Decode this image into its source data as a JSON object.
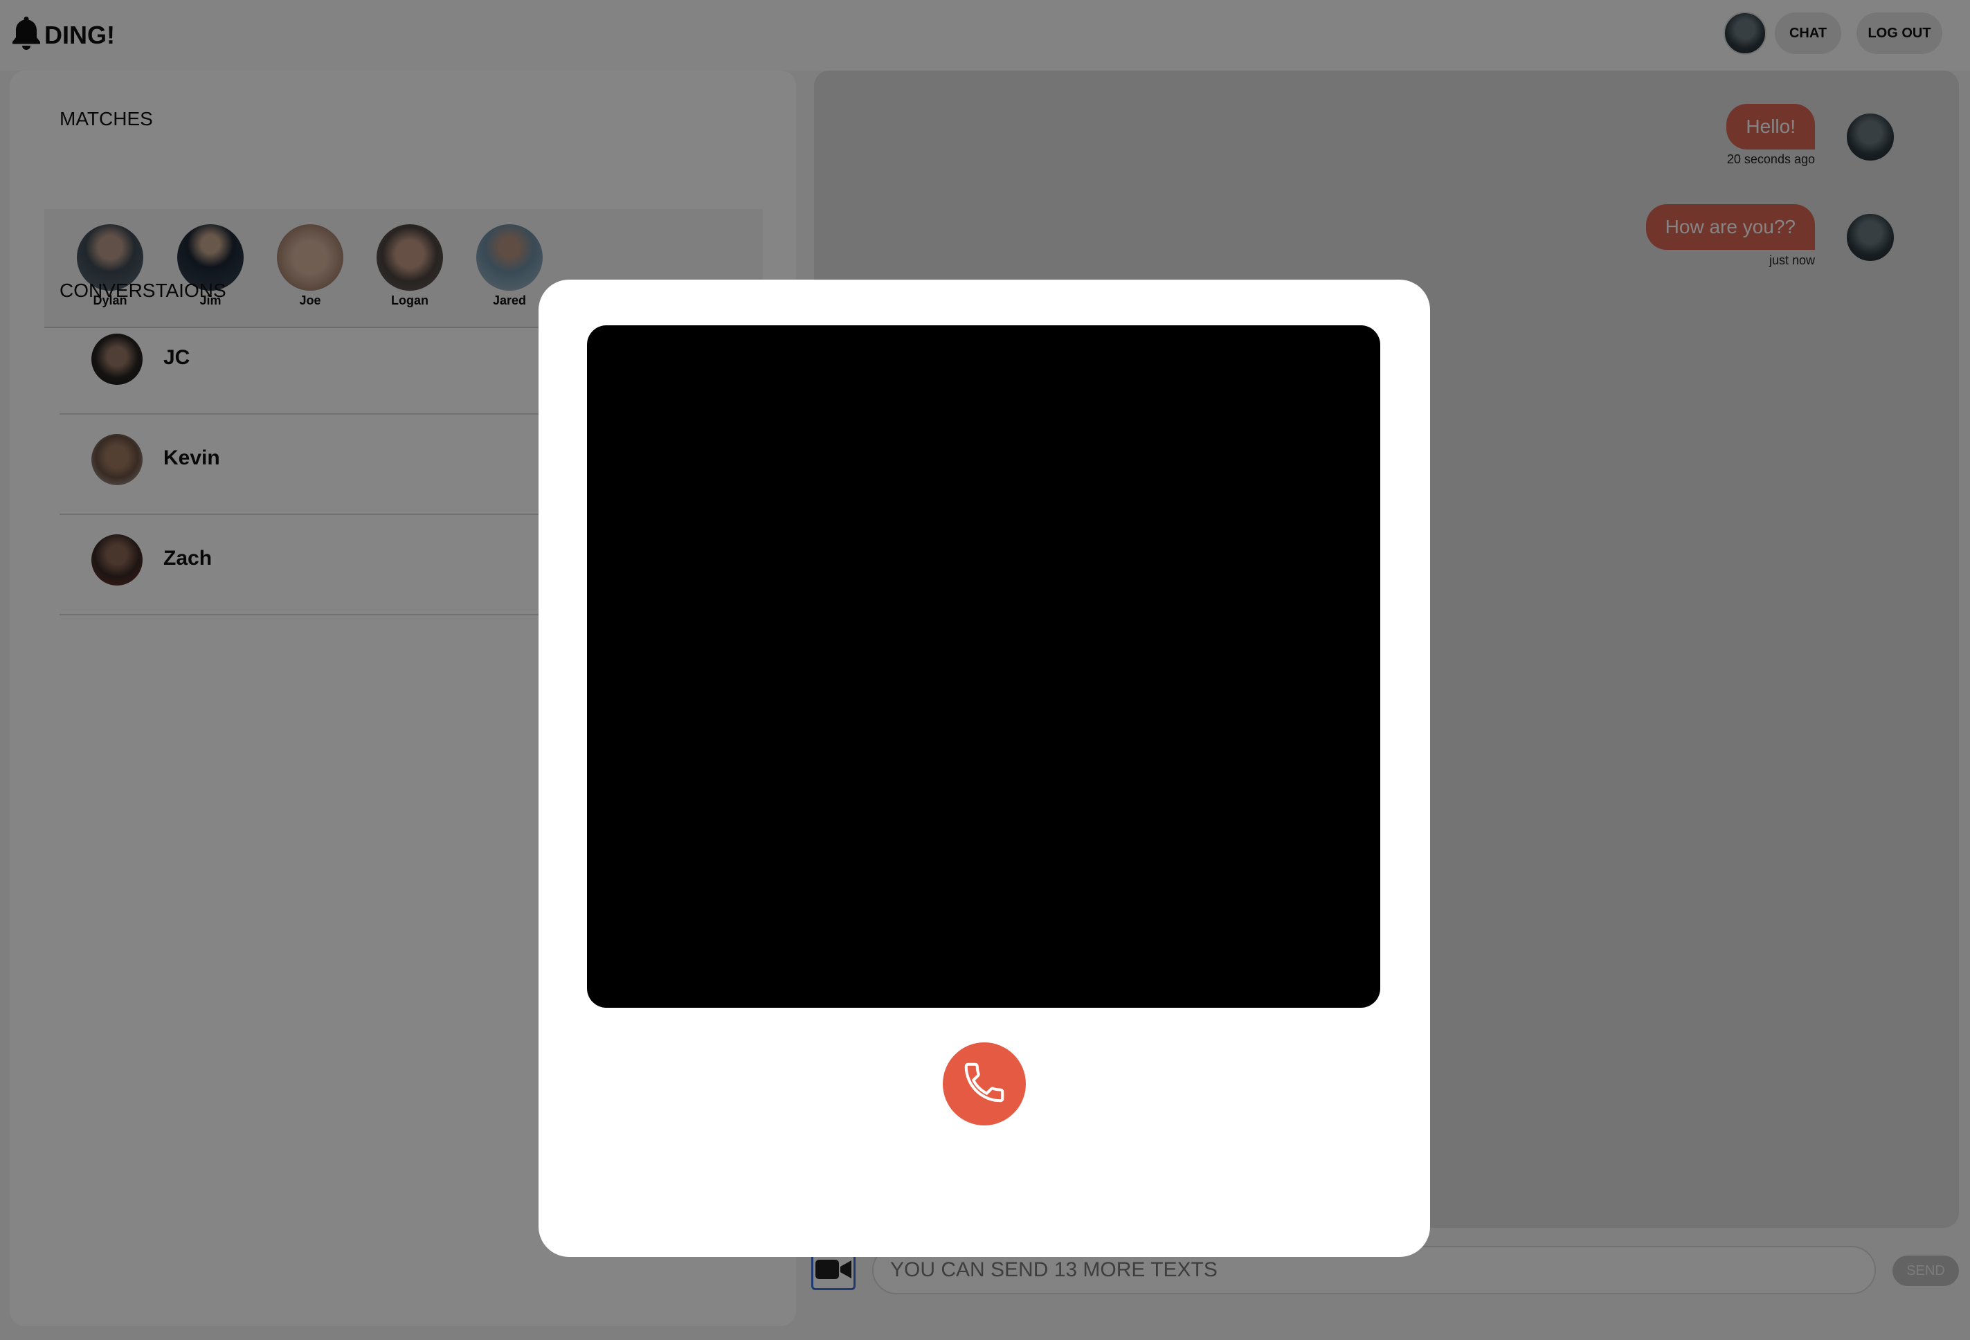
{
  "header": {
    "app_name": "DING!",
    "logo_icon": "bell-icon",
    "chat_label": "CHAT",
    "logout_label": "LOG OUT"
  },
  "matches": {
    "title": "MATCHES",
    "people": [
      {
        "name": "Dylan",
        "color": "#5c6e78"
      },
      {
        "name": "Jim",
        "color": "#2f3b4a"
      },
      {
        "name": "Joe",
        "color": "#c9a894"
      },
      {
        "name": "Logan",
        "color": "#6a6260"
      },
      {
        "name": "Jared",
        "color": "#8aa0b0"
      }
    ]
  },
  "conversations": {
    "title": "CONVERSTAIONS",
    "items": [
      {
        "name": "JC"
      },
      {
        "name": "Kevin"
      },
      {
        "name": "Zach"
      }
    ]
  },
  "chat": {
    "messages": [
      {
        "text": "Hello!",
        "time": "20 seconds ago"
      },
      {
        "text": "How are you??",
        "time": "just now"
      }
    ],
    "bubble_color": "#d96754",
    "input_placeholder": "YOU CAN SEND 13 MORE TEXTS",
    "send_label": "SEND",
    "video_icon": "video-camera-icon"
  },
  "call_modal": {
    "hangup_icon": "phone-icon",
    "hangup_color": "#e55a43"
  }
}
